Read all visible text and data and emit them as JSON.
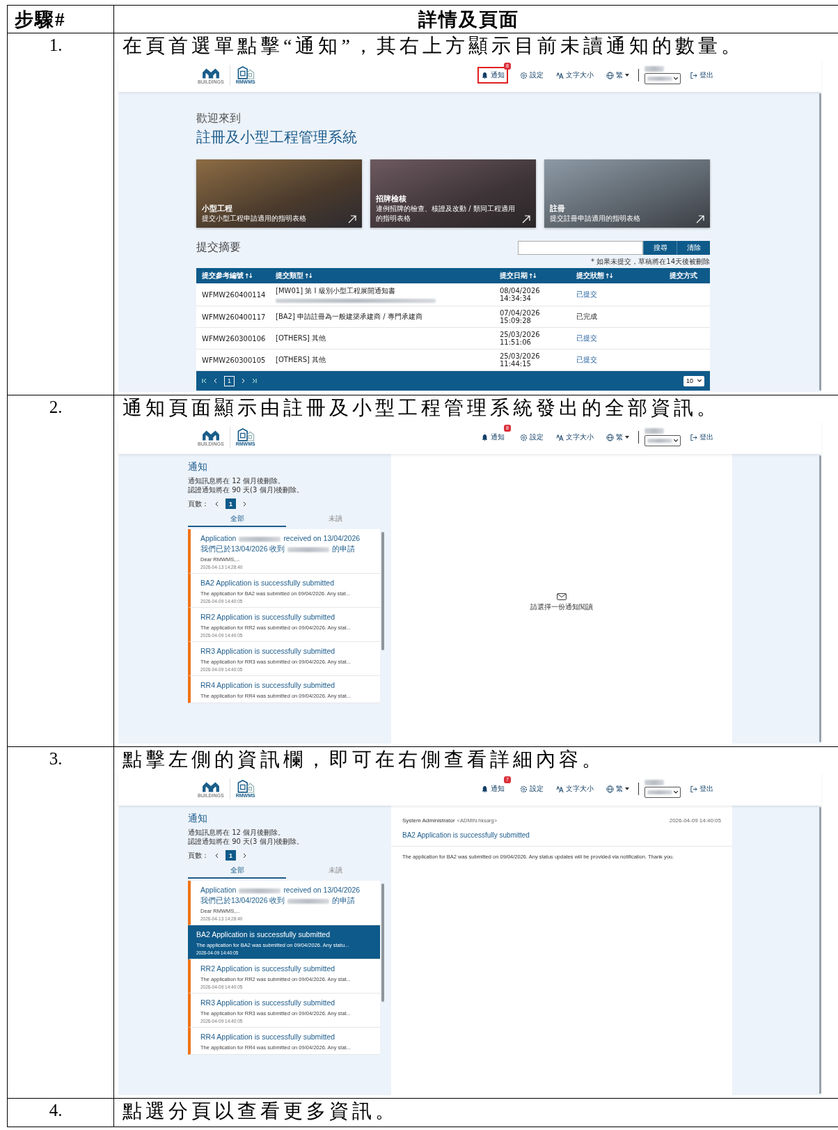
{
  "table": {
    "columns": [
      {
        "label": "步驟#"
      },
      {
        "label": "詳情及頁面"
      }
    ]
  },
  "steps": [
    {
      "number": "1.",
      "instruction": "在頁首選單點擊“通知”，其右上方顯示目前未讀通知的數量。",
      "screen": {
        "kind": "home",
        "header": {
          "logo_caption": "BUILDINGS",
          "app_logo": "RMWMS",
          "notifications": {
            "label": "通知",
            "badge": "8",
            "highlighted": true
          },
          "settings": "設定",
          "font_size": "文字大小",
          "language": "繁",
          "logout": "登出"
        },
        "welcome": "歡迎來到",
        "system_name": "註冊及小型工程管理系統",
        "cards": [
          {
            "title": "小型工程",
            "subtitle": "提交小型工程申請適用的指明表格"
          },
          {
            "title": "招牌檢核",
            "subtitle": "違例招牌的檢查、核證及改動 / 類同工程適用的指明表格"
          },
          {
            "title": "註冊",
            "subtitle": "提交註冊申請適用的指明表格"
          }
        ],
        "summary": {
          "title": "提交摘要",
          "search_button": "搜尋",
          "clear_button": "清除",
          "note": "* 如果未提交，草稿將在14天後被刪除",
          "columns": [
            {
              "label": "提交參考編號",
              "sortable": true
            },
            {
              "label": "提交類型",
              "sortable": true
            },
            {
              "label": "提交日期",
              "sortable": true
            },
            {
              "label": "提交狀態",
              "sortable": true
            },
            {
              "label": "提交方式",
              "sortable": false
            }
          ],
          "rows": [
            {
              "ref": "WFMW260400114",
              "type": "[MW01] 第 I 級別小型工程展開通知書",
              "redacted_line": true,
              "date": "08/04/2026 14:34:34",
              "status": "已提交",
              "linked": true
            },
            {
              "ref": "WFMW260400117",
              "type": "[BA2] 申請註冊為一般建築承建商 / 專門承建商",
              "redacted_line": false,
              "date": "07/04/2026 15:09:28",
              "status": "已完成",
              "linked": false
            },
            {
              "ref": "WFMW260300106",
              "type": "[OTHERS] 其他",
              "redacted_line": false,
              "date": "25/03/2026 11:51:06",
              "status": "已提交",
              "linked": true
            },
            {
              "ref": "WFMW260300105",
              "type": "[OTHERS] 其他",
              "redacted_line": false,
              "date": "25/03/2026 11:44:15",
              "status": "已提交",
              "linked": true
            }
          ],
          "page": "1",
          "page_size": "10"
        }
      }
    },
    {
      "number": "2.",
      "instruction": "通知頁面顯示由註冊及小型工程管理系統發出的全部資訊。",
      "screen": {
        "kind": "notifications",
        "header": {
          "logo_caption": "BUILDINGS",
          "app_logo": "RMWMS",
          "notifications": {
            "label": "通知",
            "badge": "8",
            "highlighted": false
          },
          "settings": "設定",
          "font_size": "文字大小",
          "language": "繁",
          "logout": "登出"
        },
        "title": "通知",
        "notes": [
          "通知訊息將在 12 個月後刪除。",
          "認證通知將在 90 天(3 個月)後刪除。"
        ],
        "pages_label": "頁數：",
        "page": "1",
        "tabs": [
          {
            "label": "全部",
            "selected": true
          },
          {
            "label": "未讀",
            "selected": false
          }
        ],
        "items": [
          {
            "kind": "redacted",
            "title_start": "Application",
            "title_end": "received on 13/04/2026",
            "line2_start": "我們已於13/04/2026 收到",
            "line2_end": "的申請",
            "preview": "Dear RMWMS,...",
            "time": "2026-04-13 14:28:40",
            "unread": true,
            "selected": false
          },
          {
            "kind": "plain",
            "title": "BA2 Application is successfully submitted",
            "preview": "The application for BA2 was submitted on 09/04/2026. Any stat...",
            "time": "2026-04-09 14:40:05",
            "unread": true,
            "selected": false
          },
          {
            "kind": "plain",
            "title": "RR2 Application is successfully submitted",
            "preview": "The application for RR2 was submitted on 09/04/2026. Any stat...",
            "time": "2026-04-09 14:40:05",
            "unread": true,
            "selected": false
          },
          {
            "kind": "plain",
            "title": "RR3 Application is successfully submitted",
            "preview": "The application for RR3 was submitted on 09/04/2026. Any stat...",
            "time": "2026-04-09 14:40:05",
            "unread": true,
            "selected": false
          },
          {
            "kind": "plain",
            "title": "RR4 Application is successfully submitted",
            "preview": "The application for RR4 was submitted on 09/04/2026. Any stat...",
            "unread": true,
            "selected": false
          }
        ],
        "empty_message": "請選擇一份通知閱讀"
      }
    },
    {
      "number": "3.",
      "instruction": "點擊左側的資訊欄，即可在右側查看詳細內容。",
      "screen": {
        "kind": "notifications",
        "header": {
          "logo_caption": "BUILDINGS",
          "app_logo": "RMWMS",
          "notifications": {
            "label": "通知",
            "badge": "7",
            "highlighted": false
          },
          "settings": "設定",
          "font_size": "文字大小",
          "language": "繁",
          "logout": "登出"
        },
        "title": "通知",
        "notes": [
          "通知訊息將在 12 個月後刪除。",
          "認證通知將在 90 天(3 個月)後刪除。"
        ],
        "pages_label": "頁數：",
        "page": "1",
        "tabs": [
          {
            "label": "全部",
            "selected": true
          },
          {
            "label": "未讀",
            "selected": false
          }
        ],
        "items": [
          {
            "kind": "redacted",
            "title_start": "Application",
            "title_end": "received on 13/04/2026",
            "line2_start": "我們已於13/04/2026 收到",
            "line2_end": "的申請",
            "preview": "Dear RMWMS,...",
            "time": "2026-04-13 14:28:40",
            "unread": true,
            "selected": false
          },
          {
            "kind": "plain",
            "title": "BA2 Application is successfully submitted",
            "preview": "The application for BA2 was submitted on 09/04/2026. Any statu...",
            "time": "2026-04-09 14:40:05",
            "unread": false,
            "selected": true
          },
          {
            "kind": "plain",
            "title": "RR2 Application is successfully submitted",
            "preview": "The application for RR2 was submitted on 09/04/2026. Any stat...",
            "time": "2026-04-09 14:40:05",
            "unread": true,
            "selected": false
          },
          {
            "kind": "plain",
            "title": "RR3 Application is successfully submitted",
            "preview": "The application for RR3 was submitted on 09/04/2026. Any stat...",
            "time": "2026-04-09 14:40:05",
            "unread": true,
            "selected": false
          },
          {
            "kind": "plain",
            "title": "RR4 Application is successfully submitted",
            "preview": "The application for RR4 was submitted on 09/04/2026. Any stat...",
            "unread": true,
            "selected": false
          }
        ],
        "detail": {
          "sender": "System Administrator",
          "sender_email": "<ADMIN.hksarg>",
          "time": "2026-04-09 14:40:05",
          "subject": "BA2 Application is successfully submitted",
          "body": "The application for BA2 was submitted on 09/04/2026. Any status updates will be provided via notification. Thank you."
        }
      }
    },
    {
      "number": "4.",
      "instruction": "點選分頁以查看更多資訊。"
    }
  ]
}
